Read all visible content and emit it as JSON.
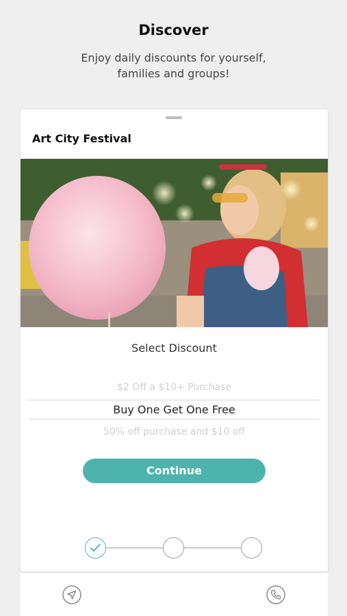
{
  "header": {
    "title": "Discover",
    "subtitle": "Enjoy daily discounts for yourself, families and groups!"
  },
  "card": {
    "title": "Art City Festival",
    "image_description_icon": "festival-photo",
    "select_label": "Select Discount",
    "discount_options": {
      "above": "$2 Off a $10+ Purchase",
      "selected": "Buy One Get One Free",
      "below": "50% off purchase and $10 off"
    },
    "continue_label": "Continue"
  },
  "steps": {
    "current": 1,
    "total": 3
  },
  "bottom_bar": {
    "left_icon": "navigation-arrow-icon",
    "right_icon": "phone-icon"
  },
  "colors": {
    "accent": "#4fb3ad",
    "background": "#efefef"
  }
}
